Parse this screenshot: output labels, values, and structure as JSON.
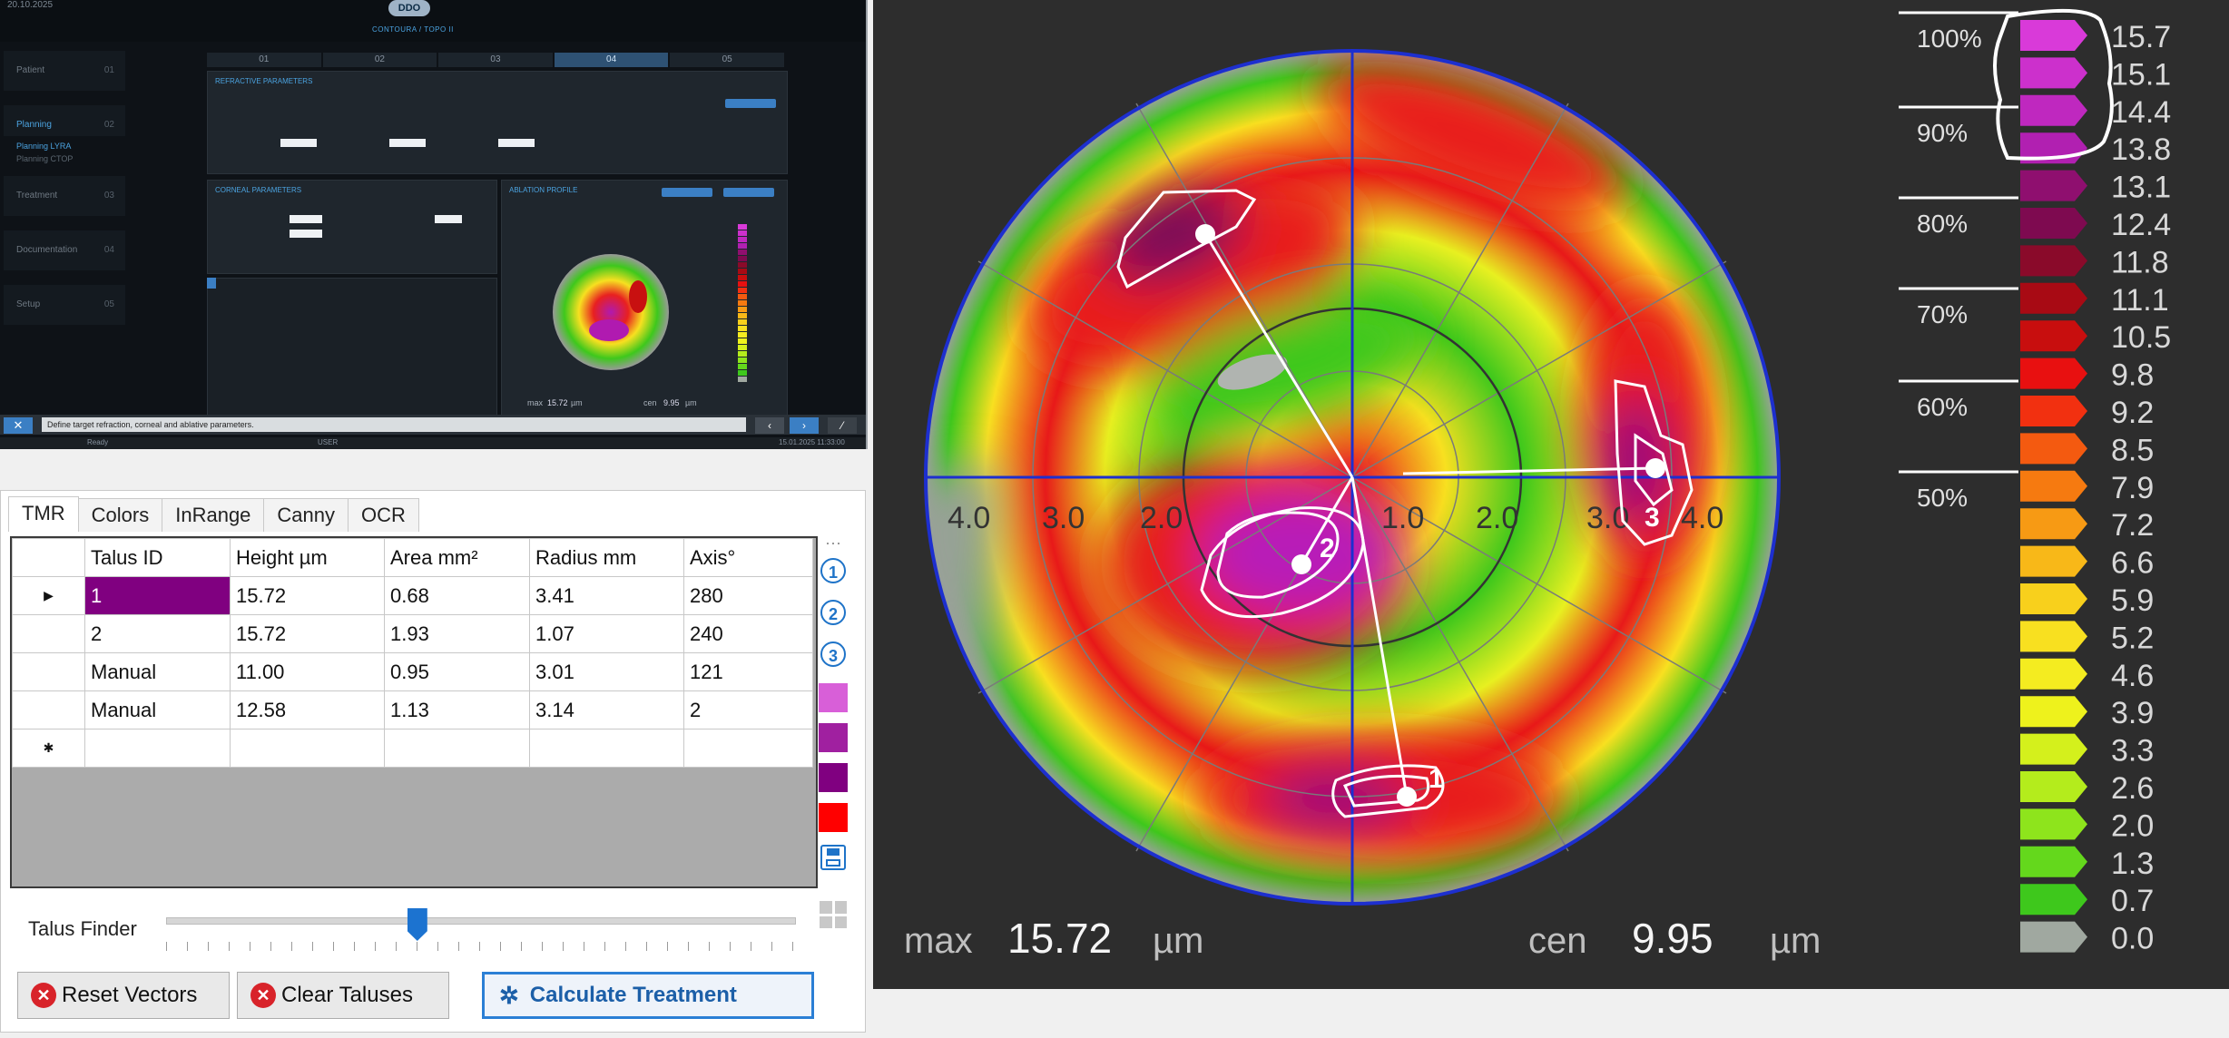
{
  "device": {
    "date": "20.10.2025",
    "logo": "DDO",
    "brand": "CONTOURA / TOPO II",
    "steps": [
      "01",
      "02",
      "03",
      "04",
      "05"
    ],
    "current_step": "04",
    "sidebar": [
      {
        "label": "Patient",
        "n": "01"
      },
      {
        "label": "Planning",
        "n": "02",
        "active": true
      },
      {
        "label": "Treatment",
        "n": "03"
      },
      {
        "label": "Documentation",
        "n": "04"
      },
      {
        "label": "Setup",
        "n": "05"
      }
    ],
    "planning_sub": [
      "Planning LYRA",
      "Planning CTOP"
    ],
    "refractive_title": "REFRACTIVE PARAMETERS",
    "corneal_title": "CORNEAL PARAMETERS",
    "ablation_title": "ABLATION PROFILE",
    "max_label": "max",
    "max_value": "15.72",
    "max_unit": "µm",
    "cen_label": "cen",
    "cen_value": "9.95",
    "cen_unit": "µm",
    "status_message": "Define target refraction, corneal and ablative parameters.",
    "ready": "Ready",
    "user": "USER",
    "clock": "15.01.2025 11:33:00"
  },
  "tabs": [
    "TMR",
    "Colors",
    "InRange",
    "Canny",
    "OCR"
  ],
  "active_tab": "TMR",
  "table": {
    "columns": [
      "Talus ID",
      "Height µm",
      "Area mm²",
      "Radius mm",
      "Axis°"
    ],
    "rows": [
      [
        "1",
        "15.72",
        "0.68",
        "3.41",
        "280"
      ],
      [
        "2",
        "15.72",
        "1.93",
        "1.07",
        "240"
      ],
      [
        "Manual",
        "11.00",
        "0.95",
        "3.01",
        "121"
      ],
      [
        "Manual",
        "12.58",
        "1.13",
        "3.14",
        "2"
      ]
    ],
    "current_row_marker": "▶",
    "new_row_marker": "✱"
  },
  "side_tools": {
    "numbers": [
      "1",
      "2",
      "3"
    ],
    "swatches": [
      "#d85fd8",
      "#a020a0",
      "#800080",
      "#ff0000"
    ]
  },
  "slider": {
    "label": "Talus Finder",
    "value_fraction": 0.4
  },
  "buttons": {
    "reset_vectors": "Reset Vectors",
    "clear_taluses": "Clear Taluses",
    "calculate": "Calculate Treatment"
  },
  "map": {
    "axis_labels_left": [
      "4.0",
      "3.0",
      "2.0",
      "1.0"
    ],
    "axis_labels_right": [
      "1.0",
      "2.0",
      "3.0",
      "4.0"
    ],
    "talus_labels": [
      "2",
      "1",
      "3"
    ],
    "max_label": "max",
    "max_value": "15.72",
    "max_unit": "µm",
    "cen_label": "cen",
    "cen_value": "9.95",
    "cen_unit": "µm"
  },
  "legend": {
    "values": [
      "15.7",
      "15.1",
      "14.4",
      "13.8",
      "13.1",
      "12.4",
      "11.8",
      "11.1",
      "10.5",
      "9.8",
      "9.2",
      "8.5",
      "7.9",
      "7.2",
      "6.6",
      "5.9",
      "5.2",
      "4.6",
      "3.9",
      "3.3",
      "2.6",
      "2.0",
      "1.3",
      "0.7",
      "0.0"
    ],
    "colors": [
      "#d93ad9",
      "#cc30cc",
      "#bf28bf",
      "#b120b1",
      "#8f0f6f",
      "#7e0a50",
      "#8a0a2a",
      "#a80a14",
      "#c80e0e",
      "#e81010",
      "#f23010",
      "#f45a10",
      "#f67a10",
      "#f79a14",
      "#f8b818",
      "#f8d01c",
      "#f8e020",
      "#f4ec20",
      "#eef21c",
      "#d4f01c",
      "#b4ec1c",
      "#8ee41c",
      "#64d81c",
      "#3ec81c",
      "#a0a8a0"
    ],
    "percents": [
      "100%",
      "90%",
      "80%",
      "70%",
      "60%",
      "50%"
    ]
  }
}
